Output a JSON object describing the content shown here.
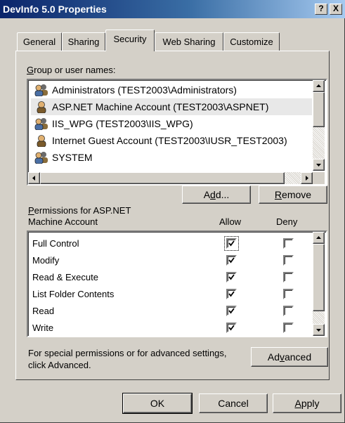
{
  "window": {
    "title": "DevInfo 5.0 Properties",
    "help_glyph": "?",
    "close_glyph": "X"
  },
  "tabs": [
    {
      "label": "General",
      "active": false
    },
    {
      "label": "Sharing",
      "active": false
    },
    {
      "label": "Security",
      "active": true
    },
    {
      "label": "Web Sharing",
      "active": false
    },
    {
      "label": "Customize",
      "active": false
    }
  ],
  "group": {
    "label_prefix": "G",
    "label_rest": "roup or user names:",
    "users": [
      {
        "name": "Administrators (TEST2003\\Administrators)",
        "icon": "group-icon",
        "selected": false
      },
      {
        "name": "ASP.NET Machine Account (TEST2003\\ASPNET)",
        "icon": "user-icon",
        "selected": true
      },
      {
        "name": "IIS_WPG (TEST2003\\IIS_WPG)",
        "icon": "group-icon",
        "selected": false
      },
      {
        "name": "Internet Guest Account (TEST2003\\IUSR_TEST2003)",
        "icon": "user-icon",
        "selected": false
      },
      {
        "name": "SYSTEM",
        "icon": "group-icon",
        "selected": false
      }
    ]
  },
  "buttons": {
    "add_pre": "A",
    "add_ul": "d",
    "add_post": "d...",
    "remove_ul": "R",
    "remove_post": "emove",
    "advanced_pre": "Ad",
    "advanced_ul": "v",
    "advanced_post": "anced",
    "ok": "OK",
    "cancel": "Cancel",
    "apply_ul": "A",
    "apply_post": "pply"
  },
  "permissions": {
    "heading_ul": "P",
    "heading_line1_rest": "ermissions for ASP.NET",
    "heading_line2": "Machine Account",
    "allow_header": "Allow",
    "deny_header": "Deny",
    "rows": [
      {
        "name": "Full Control",
        "allow": true,
        "deny": false
      },
      {
        "name": "Modify",
        "allow": true,
        "deny": false
      },
      {
        "name": "Read & Execute",
        "allow": true,
        "deny": false
      },
      {
        "name": "List Folder Contents",
        "allow": true,
        "deny": false
      },
      {
        "name": "Read",
        "allow": true,
        "deny": false
      },
      {
        "name": "Write",
        "allow": true,
        "deny": false
      }
    ]
  },
  "special": {
    "line1": "For special permissions or for advanced settings,",
    "line2": "click Advanced."
  }
}
